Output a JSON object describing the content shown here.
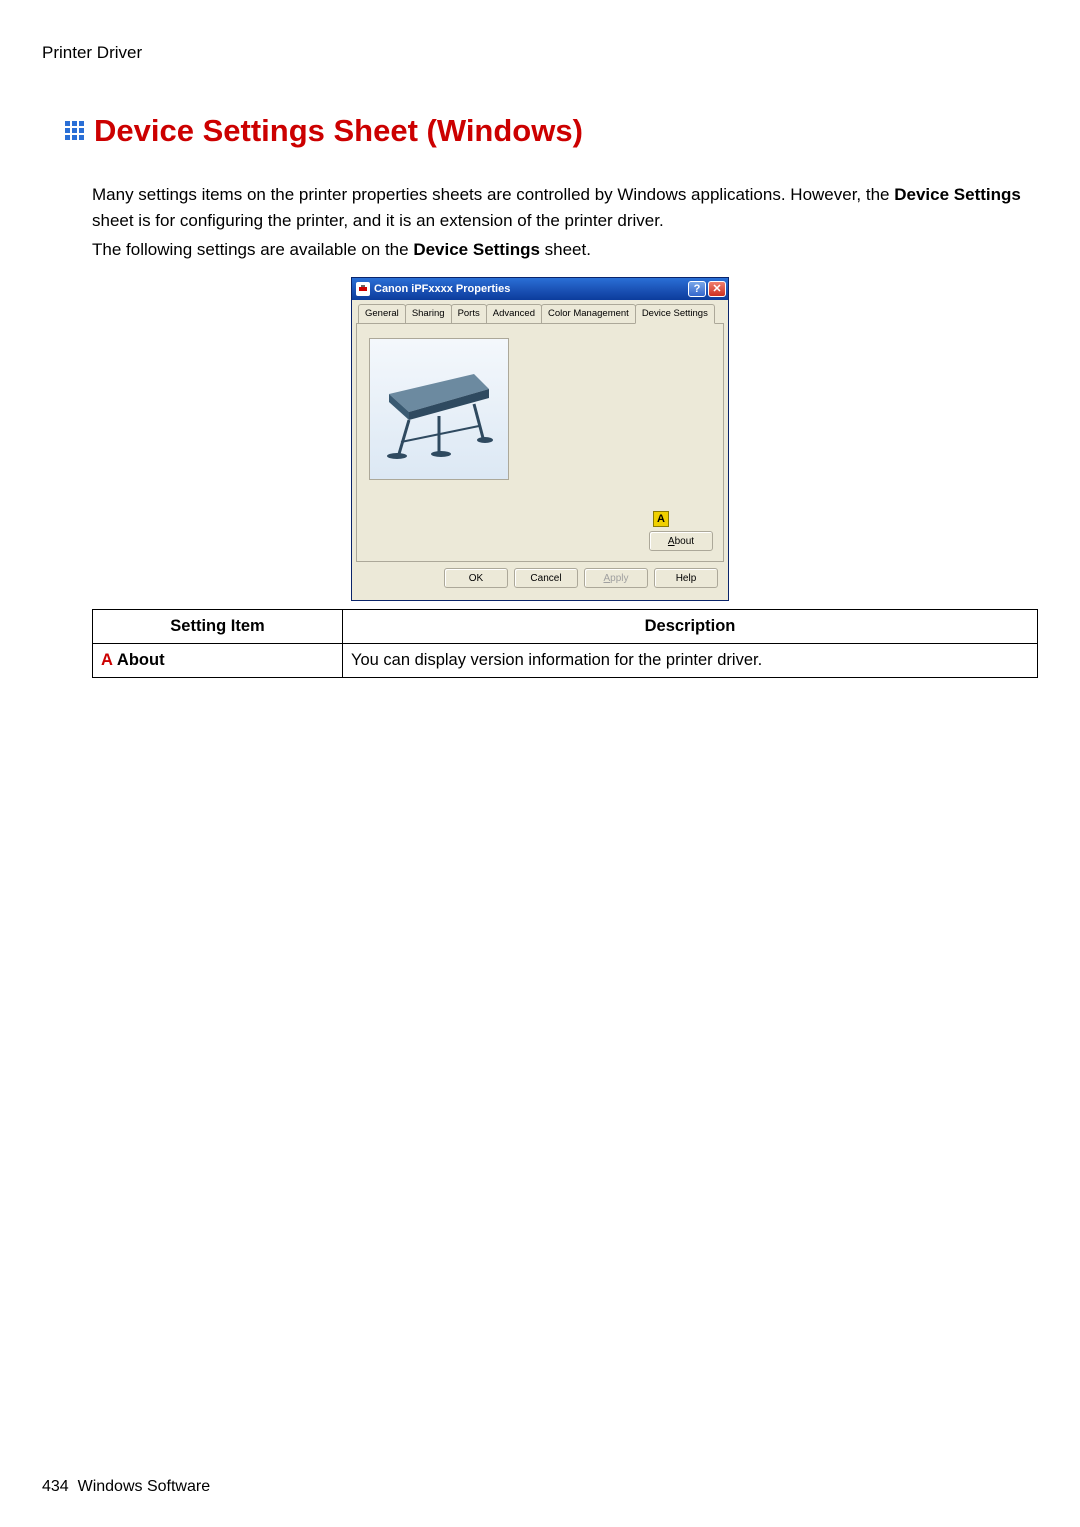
{
  "breadcrumb": "Printer Driver",
  "heading": "Device Settings Sheet (Windows)",
  "para": {
    "p1a": "Many settings items on the printer properties sheets are controlled by Windows applications. However, the ",
    "p1b": "Device Settings",
    "p1c": " sheet is for configuring the printer, and it is an extension of the printer driver.",
    "p2a": "The following settings are available on the ",
    "p2b": "Device Settings",
    "p2c": " sheet."
  },
  "dialog": {
    "title": "Canon iPFxxxx Properties",
    "help_char": "?",
    "close_char": "✕",
    "tabs": [
      "General",
      "Sharing",
      "Ports",
      "Advanced",
      "Color Management",
      "Device Settings"
    ],
    "active_index": 5,
    "callout": "A",
    "about_label_pre": "A",
    "about_label_rest": "bout",
    "buttons": {
      "ok": "OK",
      "cancel": "Cancel",
      "apply_pre": "A",
      "apply_rest": "pply",
      "help": "Help"
    }
  },
  "table": {
    "headers": [
      "Setting Item",
      "Description"
    ],
    "row_letter": "A",
    "row_label": "About",
    "row_desc": "You can display version information for the printer driver."
  },
  "footer": {
    "page_number": "434",
    "section": "Windows Software"
  }
}
